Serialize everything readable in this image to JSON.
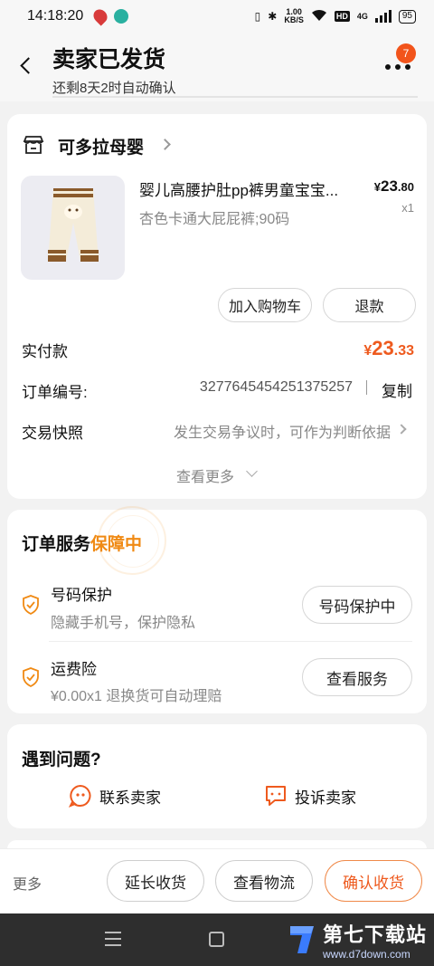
{
  "status_bar": {
    "time": "14:18:20",
    "net_speed_value": "1.00",
    "net_speed_unit": "KB/S",
    "hd": "HD",
    "signal": "4G",
    "battery": "95"
  },
  "header": {
    "title": "卖家已发货",
    "subtitle": "还剩8天2时自动确认",
    "badge_count": "7"
  },
  "shop": {
    "name": "可多拉母婴"
  },
  "product": {
    "title": "婴儿高腰护肚pp裤男童宝宝...",
    "price_symbol": "¥",
    "price_int": "23",
    "price_dec": ".80",
    "quantity": "x1",
    "spec": "杏色卡通大屁屁裤;90码"
  },
  "actions": {
    "add_cart": "加入购物车",
    "refund": "退款"
  },
  "order": {
    "paid_label": "实付款",
    "paid_symbol": "¥",
    "paid_int": "23",
    "paid_dec": ".33",
    "number_label": "订单编号:",
    "number_value": "3277645454251375257",
    "copy": "复制",
    "snapshot_label": "交易快照",
    "snapshot_hint": "发生交易争议时，可作为判断依据",
    "see_more": "查看更多"
  },
  "service": {
    "title_prefix": "订单服务",
    "title_highlight": "保障中",
    "items": [
      {
        "name": "号码保护",
        "desc": "隐藏手机号，保护隐私",
        "button": "号码保护中"
      },
      {
        "name": "运费险",
        "desc": "¥0.00x1  退换货可自动理赔",
        "button": "查看服务"
      }
    ]
  },
  "problem": {
    "title": "遇到问题?",
    "contact_seller": "联系卖家",
    "complain_seller": "投诉卖家"
  },
  "bottom_bar": {
    "more": "更多",
    "extend": "延长收货",
    "logistics": "查看物流",
    "confirm": "确认收货"
  },
  "watermark": {
    "main": "第七下载站",
    "url": "www.d7down.com"
  },
  "colors": {
    "accent_orange": "#ee5a1e",
    "guarantee_orange": "#f08a14",
    "badge_red": "#f2541b",
    "page_bg": "#f2f2f2"
  }
}
